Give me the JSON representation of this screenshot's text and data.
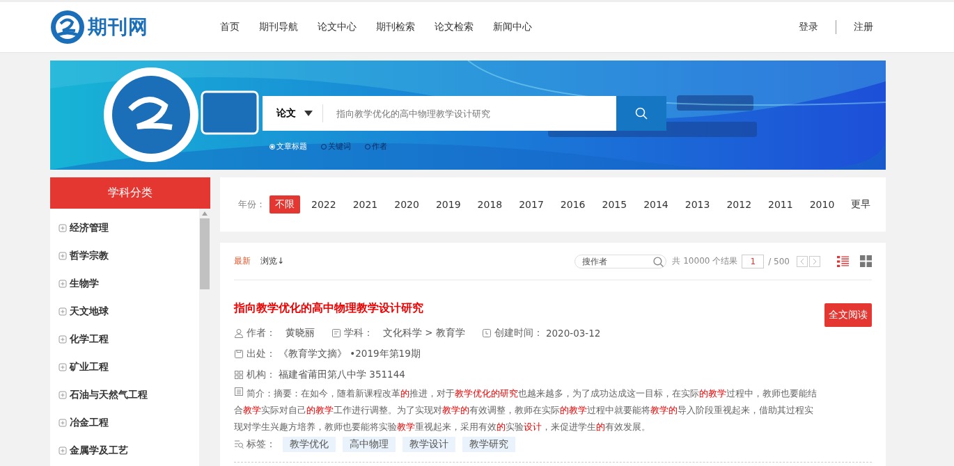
{
  "header": {
    "logo_text": "期刊网",
    "nav": [
      {
        "label": "首页"
      },
      {
        "label": "期刊导航"
      },
      {
        "label": "论文中心"
      },
      {
        "label": "期刊检索"
      },
      {
        "label": "论文检索"
      },
      {
        "label": "新闻中心"
      }
    ],
    "auth": [
      "登录",
      "注册"
    ]
  },
  "banner": {
    "search": {
      "type": "论文",
      "placeholder": "指向教学优化的高中物理教学设计研究"
    },
    "options": [
      {
        "label": "文章标题",
        "selected": true
      },
      {
        "label": "关键词",
        "selected": false
      },
      {
        "label": "作者",
        "selected": false
      }
    ]
  },
  "sidebar": {
    "title": "学科分类",
    "items": [
      {
        "label": "经济管理"
      },
      {
        "label": "哲学宗教"
      },
      {
        "label": "生物学"
      },
      {
        "label": "天文地球"
      },
      {
        "label": "化学工程"
      },
      {
        "label": "矿业工程"
      },
      {
        "label": "石油与天然气工程"
      },
      {
        "label": "冶金工程"
      },
      {
        "label": "金属学及工艺"
      }
    ]
  },
  "years": {
    "label": "年份：",
    "items": [
      {
        "label": "不限",
        "selected": true
      },
      {
        "label": "2022",
        "selected": false
      },
      {
        "label": "2021",
        "selected": false
      },
      {
        "label": "2020",
        "selected": false
      },
      {
        "label": "2019",
        "selected": false
      },
      {
        "label": "2018",
        "selected": false
      },
      {
        "label": "2017",
        "selected": false
      },
      {
        "label": "2016",
        "selected": false
      },
      {
        "label": "2015",
        "selected": false
      },
      {
        "label": "2014",
        "selected": false
      },
      {
        "label": "2013",
        "selected": false
      },
      {
        "label": "2012",
        "selected": false
      },
      {
        "label": "2011",
        "selected": false
      },
      {
        "label": "2010",
        "selected": false
      },
      {
        "label": "更早",
        "selected": false
      }
    ]
  },
  "toolbar": {
    "sorts": [
      {
        "label": "最新",
        "selected": true
      },
      {
        "label": "浏览↓",
        "selected": false
      }
    ],
    "author_search": {
      "placeholder": "搜作者"
    },
    "total": "共 10000 个结果",
    "page": "1",
    "pages": "/ 500",
    "views": [
      {
        "kind": "list",
        "selected": true
      },
      {
        "kind": "grid",
        "selected": false
      }
    ]
  },
  "results": [
    {
      "title": "指向教学优化的高中物理教学设计研究",
      "read_button": "全文阅读",
      "author_label": "作者：",
      "author": "黄晓丽",
      "subject_label": "学科：",
      "subject": "文化科学 > 教育学",
      "created_label": "创建时间：",
      "created": "2020-03-12",
      "source_label": "出处：",
      "source": "《教育学文摘》 •2019年第19期",
      "org_label": "机构：",
      "org": "福建省莆田第八中学 351144",
      "summary_label": "简介：",
      "summary": [
        {
          "text": "摘要：在如今，随着新课程改革",
          "highlight": false
        },
        {
          "text": "的",
          "highlight": true
        },
        {
          "text": "推进，对于",
          "highlight": false
        },
        {
          "text": "教学优化的研究",
          "highlight": true
        },
        {
          "text": "也越来越多，为了成功达成这一目标，在实际",
          "highlight": false
        },
        {
          "text": "的教学",
          "highlight": true
        },
        {
          "text": "过程中，教师也要能结合",
          "highlight": false
        },
        {
          "text": "教学",
          "highlight": true
        },
        {
          "text": "实际对自己",
          "highlight": false
        },
        {
          "text": "的教学",
          "highlight": true
        },
        {
          "text": "工作进行调整。为了实现对",
          "highlight": false
        },
        {
          "text": "教学的",
          "highlight": true
        },
        {
          "text": "有效调整，教师在实际",
          "highlight": false
        },
        {
          "text": "的教学",
          "highlight": true
        },
        {
          "text": "过程中就要能将",
          "highlight": false
        },
        {
          "text": "教学的",
          "highlight": true
        },
        {
          "text": "导入阶段重视起来，借助其过程实现对学生兴趣方培养，教师也要能将实验",
          "highlight": false
        },
        {
          "text": "教学",
          "highlight": true
        },
        {
          "text": "重视起来，采用有效",
          "highlight": false
        },
        {
          "text": "的",
          "highlight": true
        },
        {
          "text": "实验",
          "highlight": false
        },
        {
          "text": "设计",
          "highlight": true
        },
        {
          "text": "，来促进学生",
          "highlight": false
        },
        {
          "text": "的",
          "highlight": true
        },
        {
          "text": "有效发展。",
          "highlight": false
        }
      ],
      "tags_label": "标签：",
      "tags": [
        "教学优化",
        "高中物理",
        "教学设计",
        "教学研究"
      ]
    }
  ]
}
